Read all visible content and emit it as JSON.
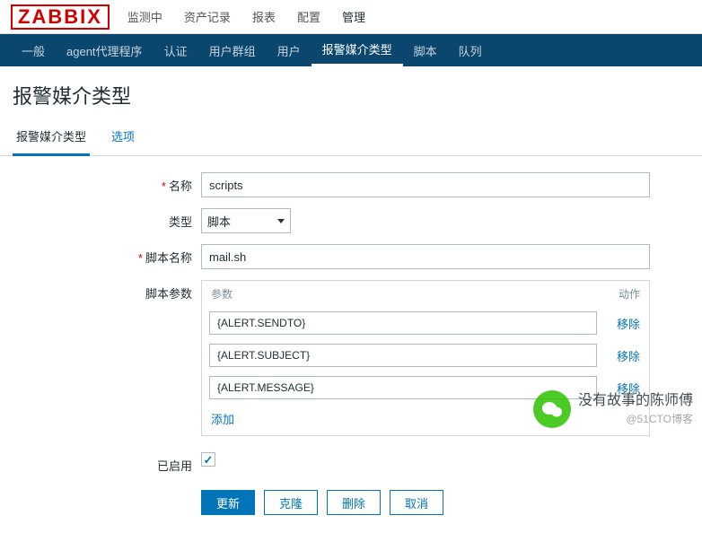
{
  "logo": "ZABBIX",
  "top_nav": [
    "监测中",
    "资产记录",
    "报表",
    "配置",
    "管理"
  ],
  "top_nav_active": 4,
  "sub_nav": [
    "一般",
    "agent代理程序",
    "认证",
    "用户群组",
    "用户",
    "报警媒介类型",
    "脚本",
    "队列"
  ],
  "sub_nav_active": 5,
  "page_title": "报警媒介类型",
  "tabs": [
    "报警媒介类型",
    "选项"
  ],
  "tabs_active": 0,
  "form": {
    "labels": {
      "name": "名称",
      "type": "类型",
      "script_name": "脚本名称",
      "script_params": "脚本参数",
      "enabled": "已启用"
    },
    "name_value": "scripts",
    "type_value": "脚本",
    "script_name_value": "mail.sh",
    "params_header": {
      "param": "参数",
      "action": "动作"
    },
    "params": [
      "{ALERT.SENDTO}",
      "{ALERT.SUBJECT}",
      "{ALERT.MESSAGE}"
    ],
    "remove_label": "移除",
    "add_label": "添加",
    "enabled_checked": true
  },
  "buttons": {
    "update": "更新",
    "clone": "克隆",
    "delete": "删除",
    "cancel": "取消"
  },
  "watermark": {
    "main": "没有故事的陈师傅",
    "sub": "@51CTO博客"
  }
}
